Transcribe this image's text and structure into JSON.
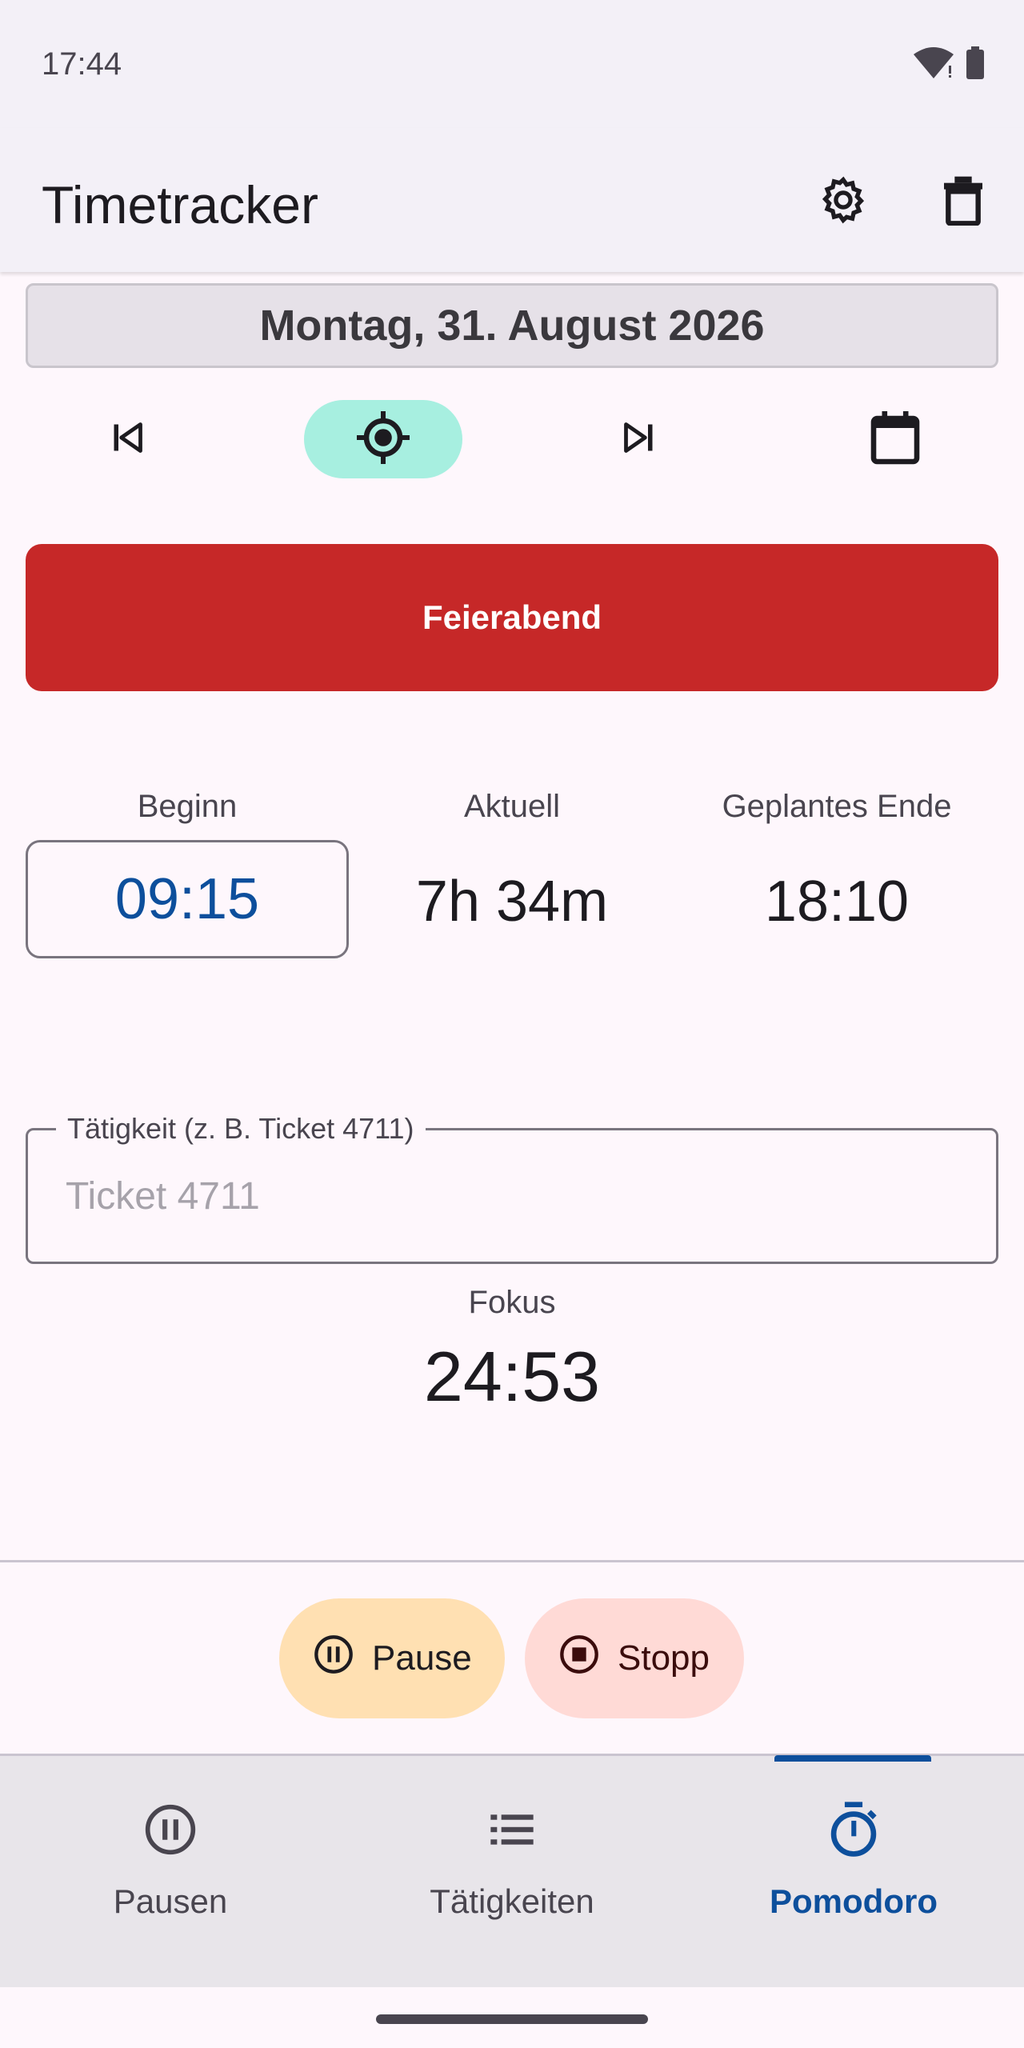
{
  "status_bar": {
    "time": "17:44",
    "icons": [
      "wifi-icon",
      "battery-icon"
    ]
  },
  "app_bar": {
    "title": "Timetracker",
    "actions": [
      "settings-icon",
      "delete-icon"
    ]
  },
  "date_header": {
    "label": "Montag, 31. August 2026"
  },
  "day_navigation": {
    "buttons": [
      "skip-previous-icon",
      "today-target-icon",
      "skip-next-icon",
      "calendar-icon"
    ],
    "active_button": "today-target-icon"
  },
  "end_day_button": {
    "label": "Feierabend",
    "color": "#c62828"
  },
  "time_summary": {
    "begin_label": "Beginn",
    "begin_value": "09:15",
    "current_label": "Aktuell",
    "current_value": "7h 34m",
    "planned_end_label": "Geplantes Ende",
    "planned_end_value": "18:10"
  },
  "activity_field": {
    "label": "Tätigkeit (z. B. Ticket 4711)",
    "placeholder": "Ticket 4711",
    "value": ""
  },
  "focus": {
    "label": "Fokus",
    "value": "24:53"
  },
  "timer_controls": {
    "pause_label": "Pause",
    "stop_label": "Stopp"
  },
  "bottom_nav": {
    "items": [
      {
        "label": "Pausen",
        "icon": "pause-circle-icon"
      },
      {
        "label": "Tätigkeiten",
        "icon": "list-icon"
      },
      {
        "label": "Pomodoro",
        "icon": "stopwatch-icon"
      }
    ],
    "active": "Pomodoro"
  },
  "colors": {
    "accent": "#0d4f9c",
    "today_highlight": "#a7efe0",
    "pause_pill": "#ffe0b2",
    "stop_pill": "#ffdad6"
  }
}
